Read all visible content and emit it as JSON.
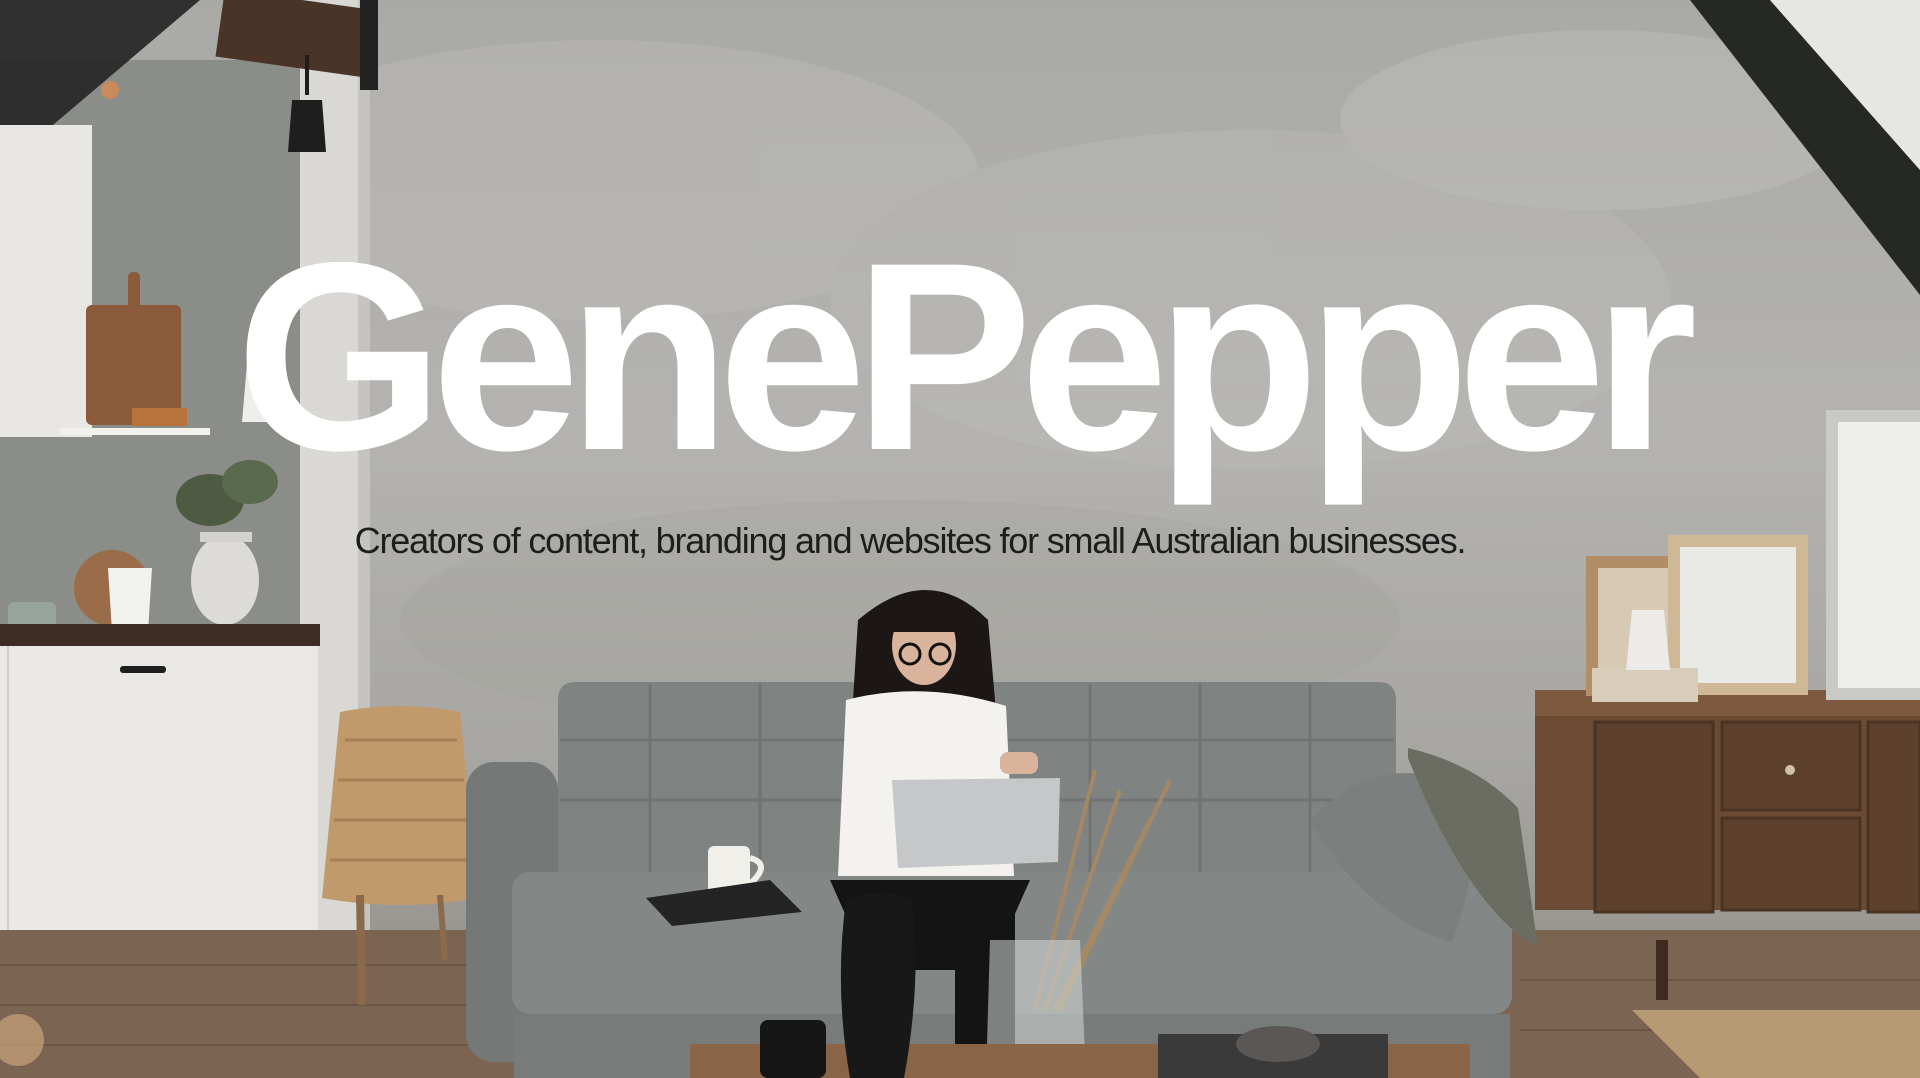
{
  "hero": {
    "title": "GenePepper",
    "tagline": "Creators of content, branding and websites for small Australian businesses."
  },
  "background": {
    "image_description": "",
    "icons": [
      "pendant-lamp-icon",
      "laptop-icon",
      "coffee-mug-icon",
      "plant-vase-icon"
    ]
  },
  "colors": {
    "title": "#ffffff",
    "tagline": "#1d1d1d",
    "wall": "#b1b0ad",
    "sofa": "#7f8482",
    "floor": "#7b6452"
  }
}
